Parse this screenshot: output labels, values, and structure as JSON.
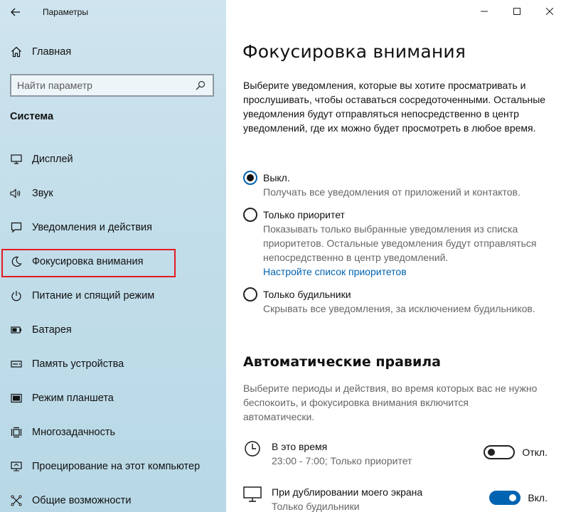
{
  "window": {
    "title": "Параметры",
    "back_icon": "back-arrow-icon",
    "controls": [
      "minimize-icon",
      "maximize-icon",
      "close-icon"
    ]
  },
  "sidebar": {
    "home_label": "Главная",
    "search_placeholder": "Найти параметр",
    "section_title": "Система",
    "items": [
      {
        "label": "Дисплей",
        "icon": "display-icon"
      },
      {
        "label": "Звук",
        "icon": "sound-icon"
      },
      {
        "label": "Уведомления и действия",
        "icon": "notifications-icon"
      },
      {
        "label": "Фокусировка внимания",
        "icon": "moon-icon",
        "selected": true
      },
      {
        "label": "Питание и спящий режим",
        "icon": "power-icon"
      },
      {
        "label": "Батарея",
        "icon": "battery-icon"
      },
      {
        "label": "Память устройства",
        "icon": "storage-icon"
      },
      {
        "label": "Режим планшета",
        "icon": "tablet-icon"
      },
      {
        "label": "Многозадачность",
        "icon": "multitasking-icon"
      },
      {
        "label": "Проецирование на этот компьютер",
        "icon": "projecting-icon"
      },
      {
        "label": "Общие возможности",
        "icon": "shared-experiences-icon"
      }
    ]
  },
  "main": {
    "title": "Фокусировка внимания",
    "description": "Выберите уведомления, которые вы хотите просматривать и прослушивать, чтобы оставаться сосредоточенными. Остальные уведомления будут отправляться непосредственно в центр уведомлений, где их можно будет просмотреть в любое время.",
    "options": [
      {
        "label": "Выкл.",
        "desc": "Получать все уведомления от приложений и контактов.",
        "checked": true
      },
      {
        "label": "Только приоритет",
        "desc": "Показывать только выбранные уведомления из списка приоритетов. Остальные уведомления будут отправляться непосредственно в центр уведомлений.",
        "link": "Настройте список приоритетов",
        "checked": false
      },
      {
        "label": "Только будильники",
        "desc": "Скрывать все уведомления, за исключением будильников.",
        "checked": false
      }
    ],
    "rules_title": "Автоматические правила",
    "rules_desc": "Выберите периоды и действия, во время которых вас не нужно беспокоить, и фокусировка внимания включится автоматически.",
    "rules": [
      {
        "title": "В это время",
        "sub": "23:00 - 7:00; Только приоритет",
        "state": "Откл.",
        "on": false,
        "icon": "clock-icon"
      },
      {
        "title": "При дублировании моего экрана",
        "sub": "Только будильники",
        "state": "Вкл.",
        "on": true,
        "icon": "monitor-icon"
      }
    ]
  },
  "colors": {
    "accent": "#0063b1",
    "selection_outline": "#e31b23"
  }
}
